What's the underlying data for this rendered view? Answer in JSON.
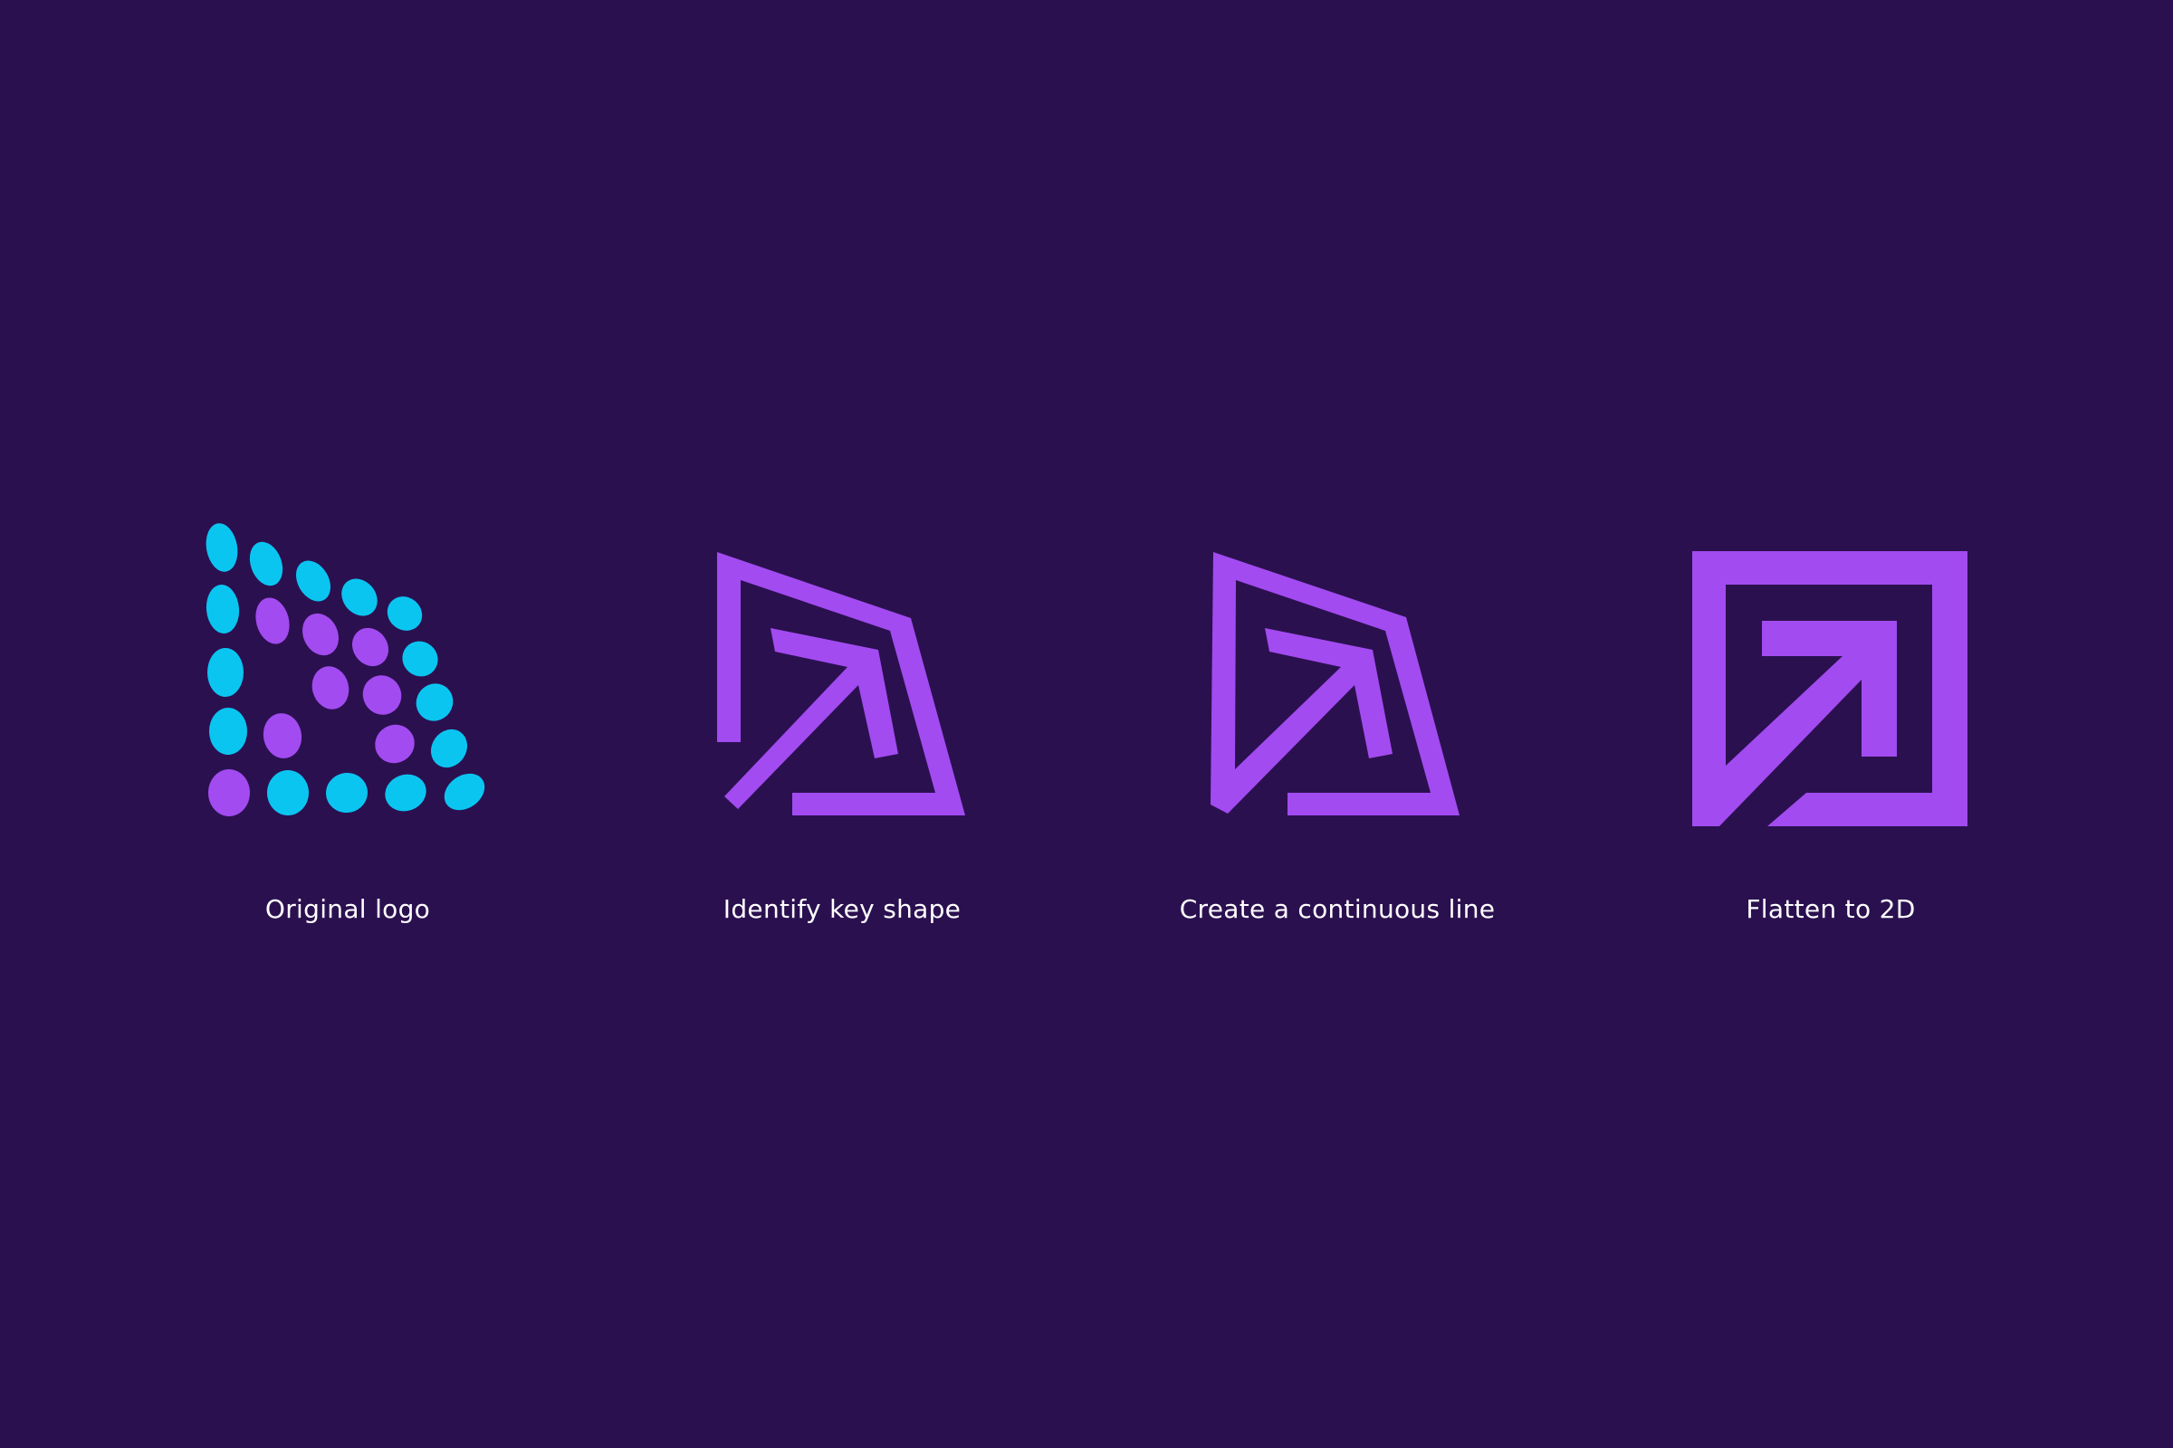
{
  "colors": {
    "background": "#2b1050",
    "cyan": "#0bc5f1",
    "purple": "#a24bf0",
    "caption_text": "#ffffff"
  },
  "steps": [
    {
      "caption": "Original logo",
      "icon": "dotted-logo-icon"
    },
    {
      "caption": "Identify key shape",
      "icon": "key-shape-outline-icon"
    },
    {
      "caption": "Create a continuous line",
      "icon": "continuous-line-icon"
    },
    {
      "caption": "Flatten to 2D",
      "icon": "flat-square-arrow-icon"
    }
  ]
}
